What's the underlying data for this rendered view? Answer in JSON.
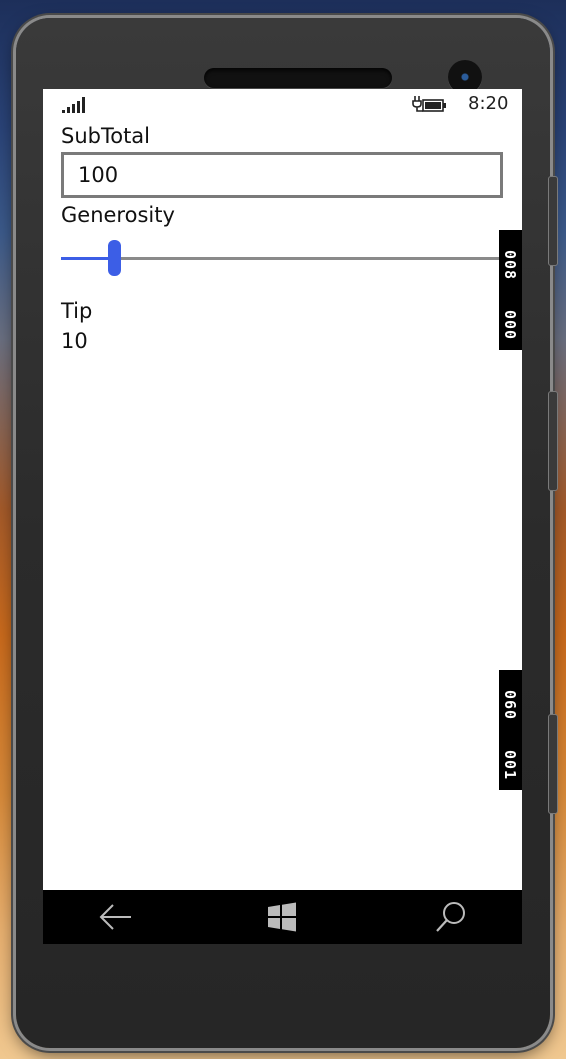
{
  "status_bar": {
    "signal_icon": "signal-bars-icon",
    "battery_icon": "battery-charging-icon",
    "time": "8:20"
  },
  "form": {
    "subtotal_label": "SubTotal",
    "subtotal_value": "100",
    "generosity_label": "Generosity",
    "generosity_level": 0.11,
    "tip_label": "Tip",
    "tip_value": "10"
  },
  "frame_counters": {
    "top": [
      "008",
      "000"
    ],
    "bottom": [
      "060",
      "001"
    ]
  },
  "navbar": {
    "back_icon": "back-arrow-icon",
    "start_icon": "windows-start-icon",
    "search_icon": "search-icon"
  },
  "colors": {
    "accent": "#3c5ee6",
    "screen_bg": "#ffffff",
    "navbar_bg": "#000000"
  }
}
